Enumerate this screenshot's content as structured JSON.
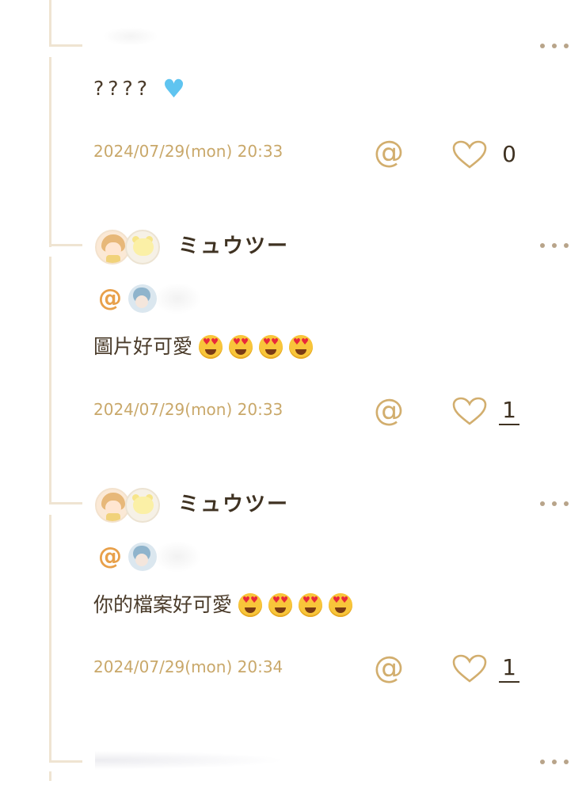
{
  "comments": [
    {
      "text": "????",
      "emoji": "blue-heart",
      "timestamp": "2024/07/29(mon) 20:33",
      "likes": "0"
    },
    {
      "username": "ミュウツー",
      "text": "圖片好可愛",
      "emoji": "heart-eyes-face",
      "emoji_count": 4,
      "timestamp": "2024/07/29(mon) 20:33",
      "likes": "1"
    },
    {
      "username": "ミュウツー",
      "text": "你的檔案好可愛",
      "emoji": "heart-eyes-face",
      "emoji_count": 4,
      "timestamp": "2024/07/29(mon) 20:34",
      "likes": "1"
    }
  ],
  "labels": {
    "mention_symbol": "@"
  },
  "colors": {
    "thread_line": "#efe4d2",
    "timestamp": "#c9a86a",
    "accent_at": "#e8a04a",
    "icon": "#d2ae6e",
    "text": "#4a3b2a"
  }
}
